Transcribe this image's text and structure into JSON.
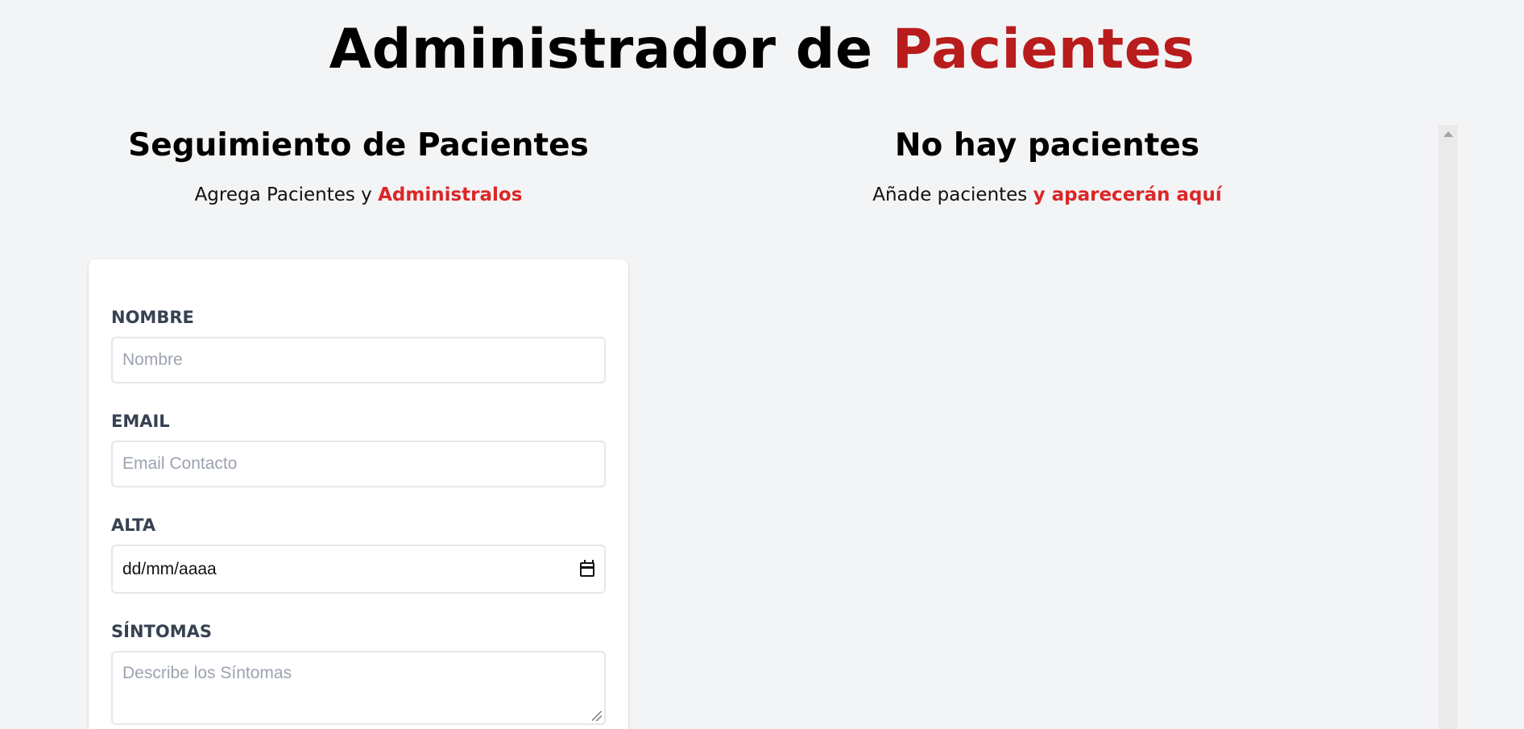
{
  "header": {
    "title_main": "Administrador de",
    "title_accent": "Pacientes"
  },
  "form_section": {
    "title": "Seguimiento de Pacientes",
    "subtitle_plain": "Agrega Pacientes y",
    "subtitle_accent": "Administralos",
    "fields": {
      "nombre": {
        "label": "NOMBRE",
        "placeholder": "Nombre",
        "value": ""
      },
      "email": {
        "label": "EMAIL",
        "placeholder": "Email Contacto",
        "value": ""
      },
      "alta": {
        "label": "ALTA",
        "value": "dd/mm/aaaa",
        "icon": "calendar-icon"
      },
      "sintomas": {
        "label": "SÍNTOMAS",
        "placeholder": "Describe los Síntomas",
        "value": ""
      }
    }
  },
  "list_section": {
    "title": "No hay pacientes",
    "subtitle_plain": "Añade pacientes",
    "subtitle_accent": "y aparecerán aquí"
  },
  "colors": {
    "accent_title": "#b91c1c",
    "accent_text": "#dc2626",
    "background": "#f3f4f6",
    "label": "#374151"
  }
}
